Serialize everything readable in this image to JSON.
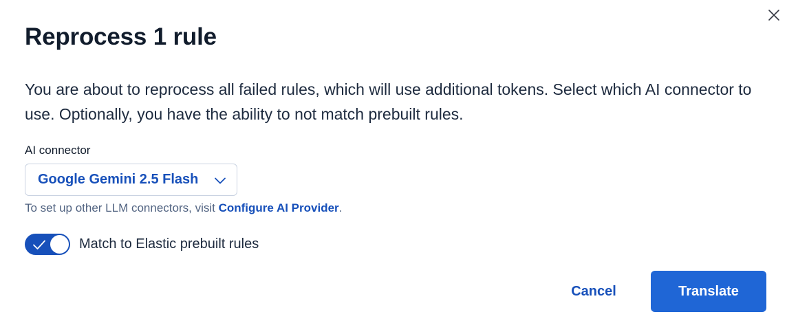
{
  "modal": {
    "title": "Reprocess 1 rule",
    "description": "You are about to reprocess all failed rules, which will use additional tokens. Select which AI connector to use. Optionally, you have the ability to not match prebuilt rules.",
    "close_icon": "close-icon"
  },
  "connector": {
    "label": "AI connector",
    "selected_value": "Google Gemini 2.5 Flash",
    "chevron_icon": "chevron-down-icon",
    "help_prefix": "To set up other LLM connectors, visit ",
    "help_link": "Configure AI Provider",
    "help_suffix": "."
  },
  "match_toggle": {
    "label": "Match to Elastic prebuilt rules",
    "checked": true,
    "icon": "check-icon"
  },
  "actions": {
    "cancel_label": "Cancel",
    "translate_label": "Translate"
  },
  "colors": {
    "primary": "#1f66d6",
    "link": "#1750ba",
    "text": "#1d2a3e",
    "muted": "#516381"
  }
}
